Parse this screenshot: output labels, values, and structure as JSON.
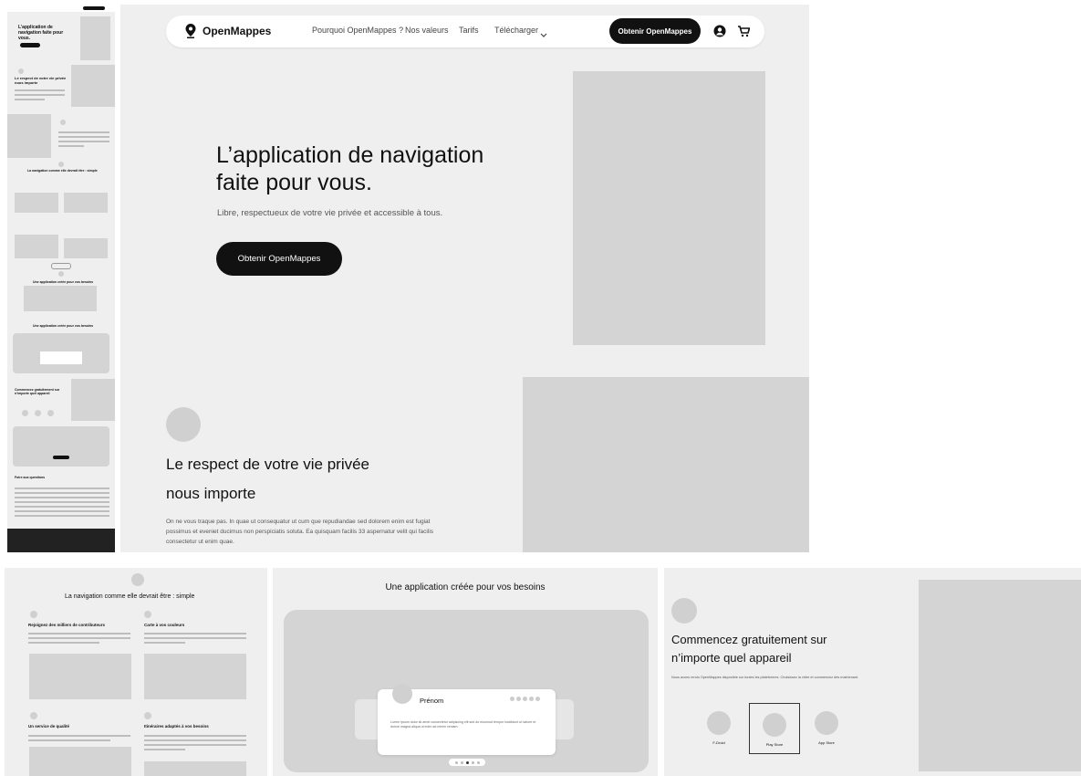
{
  "brand": {
    "name": "OpenMappes"
  },
  "nav": {
    "links": [
      "Pourquoi OpenMappes ?",
      "Nos valeurs",
      "Tarifs",
      "Télécharger"
    ],
    "cta": "Obtenir OpenMappes"
  },
  "hero": {
    "title_line1": "L’application de navigation",
    "title_line2": "faite pour vous.",
    "subtitle": "Libre, respectueux de votre vie privée et accessible à tous.",
    "cta": "Obtenir OpenMappes"
  },
  "privacy": {
    "title_line1": "Le respect de votre vie privée",
    "title_line2": "nous importe",
    "body_line1": "On ne vous traque pas. In quae ut consequatur ut cum que repudiandae sed dolorem enim est fugiat",
    "body_line2": "possimus et eveniet ducimus non perspiciatis soluta. Ea quisquam facilis 33 aspernatur velit qui facilis",
    "body_line3": "consectetur ut enim quae."
  },
  "overview": {
    "hero_title": "L’application de navigation faite pour vous.",
    "section_privacy": "Le respect de votre vie privée nous importe",
    "section_features": "La navigation comme elle devrait être : simple",
    "section_besoins": "Une application créée pour vos besoins",
    "section_start": "Commencez gratuitement sur n’importe quel appareil",
    "section_faq": "Foire aux questions"
  },
  "features": {
    "title": "La navigation comme elle devrait être : simple",
    "items": [
      "Rejoignez des milliers de contributeurs",
      "Carte à vos couleurs",
      "Un service de qualité",
      "Itinéraires adaptés à vos besoins"
    ]
  },
  "besoins": {
    "title": "Une application créée pour vos besoins",
    "testimonial_name": "Prénom",
    "testimonial_text": "Lorem ipsum dolor sit amet consectetur adipiscing elit sed do eiusmod tempor incididunt ut labore et dolore magna aliqua ut enim ad minim veniam."
  },
  "commencez": {
    "title_line1": "Commencez gratuitement sur",
    "title_line2": "n’importe quel appareil",
    "body": "Nous avons rendu OpenMappes disponible sur toutes les plateformes. Choisissez la vôtre et commencez dès maintenant.",
    "stores": [
      "F-Droid",
      "Play Store",
      "App Store"
    ]
  },
  "colors": {
    "accent": "#111111",
    "placeholder": "#d4d4d4",
    "background": "#efefef"
  }
}
